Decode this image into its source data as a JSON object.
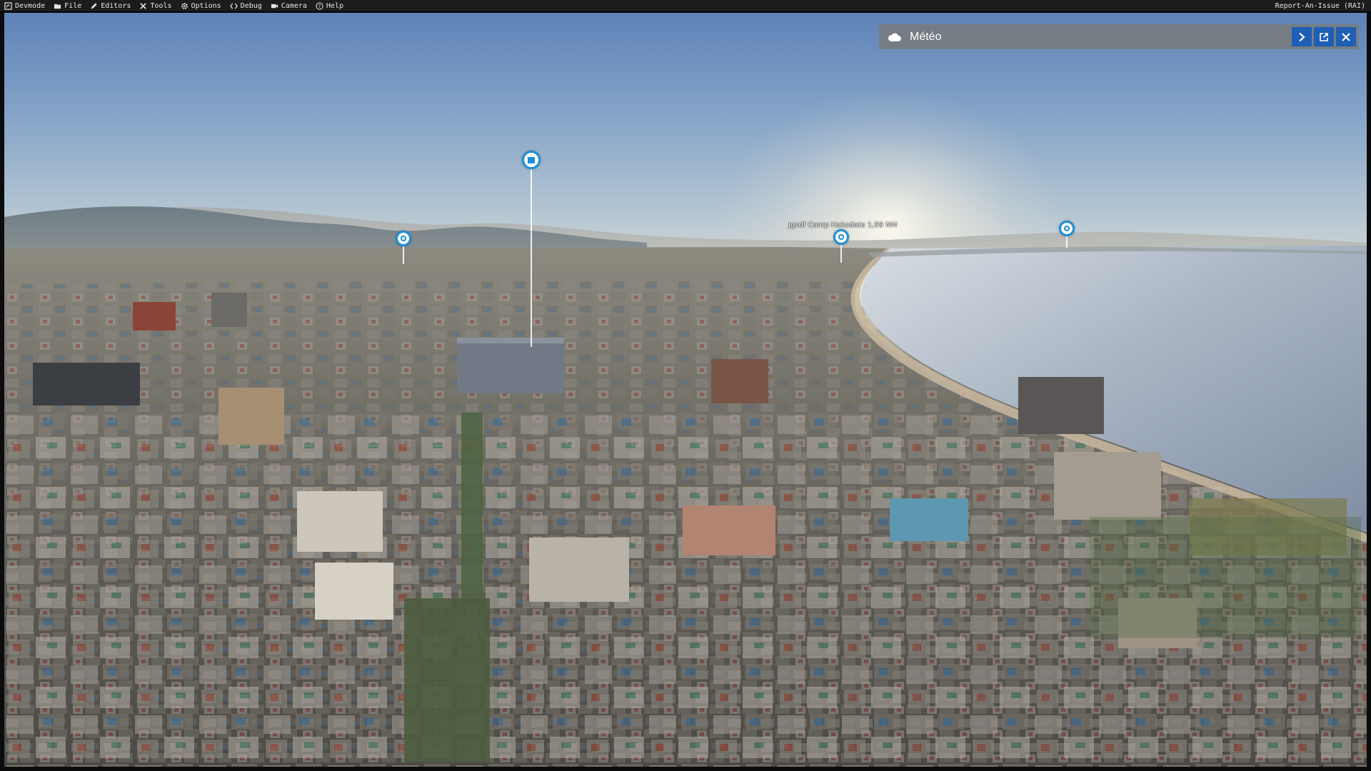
{
  "menubar": {
    "items": [
      {
        "label": "Devmode",
        "icon": "devmode-icon"
      },
      {
        "label": "File",
        "icon": "folder-icon"
      },
      {
        "label": "Editors",
        "icon": "pencil-icon"
      },
      {
        "label": "Tools",
        "icon": "tools-icon"
      },
      {
        "label": "Options",
        "icon": "gear-icon"
      },
      {
        "label": "Debug",
        "icon": "code-icon"
      },
      {
        "label": "Camera",
        "icon": "camera-icon"
      },
      {
        "label": "Help",
        "icon": "help-icon"
      }
    ],
    "report": "Report-An-Issue (RAI)"
  },
  "weather_panel": {
    "title": "Météo",
    "icon": "cloud-icon",
    "buttons": [
      "chevron-right-icon",
      "popout-icon",
      "close-icon"
    ],
    "accent": "#1e5fb5"
  },
  "pois": {
    "label": "Jgsdf Camp Hakodate  1,99  NM"
  },
  "colors": {
    "poi_ring": "#1d8fd6",
    "menubar_bg": "#1b1c1e"
  }
}
